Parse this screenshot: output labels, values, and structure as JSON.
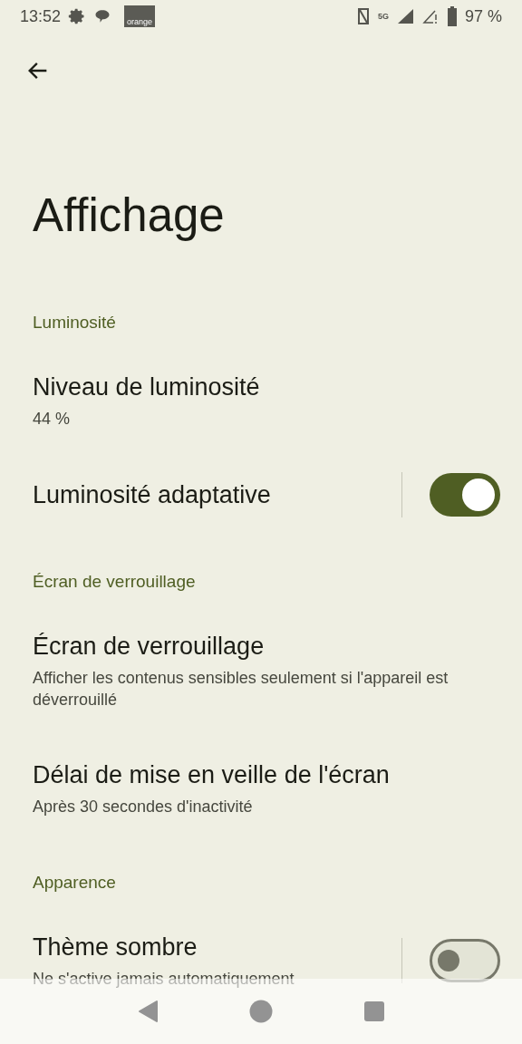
{
  "status_bar": {
    "time": "13:52",
    "carrier_logo": "orange",
    "network": "5G",
    "battery": "97 %"
  },
  "title": "Affichage",
  "sections": [
    {
      "header": "Luminosité",
      "items": [
        {
          "kind": "text",
          "title": "Niveau de luminosité",
          "summary": "44 %"
        },
        {
          "kind": "switch",
          "title": "Luminosité adaptative",
          "on": true
        }
      ]
    },
    {
      "header": "Écran de verrouillage",
      "items": [
        {
          "kind": "text",
          "title": "Écran de verrouillage",
          "summary": "Afficher les contenus sensibles seulement si l'appareil est déverrouillé"
        },
        {
          "kind": "text",
          "title": "Délai de mise en veille de l'écran",
          "summary": "Après 30 secondes d'inactivité"
        }
      ]
    },
    {
      "header": "Apparence",
      "items": [
        {
          "kind": "switch",
          "title": "Thème sombre",
          "summary": "Ne s'active jamais automatiquement",
          "on": false
        }
      ]
    }
  ]
}
